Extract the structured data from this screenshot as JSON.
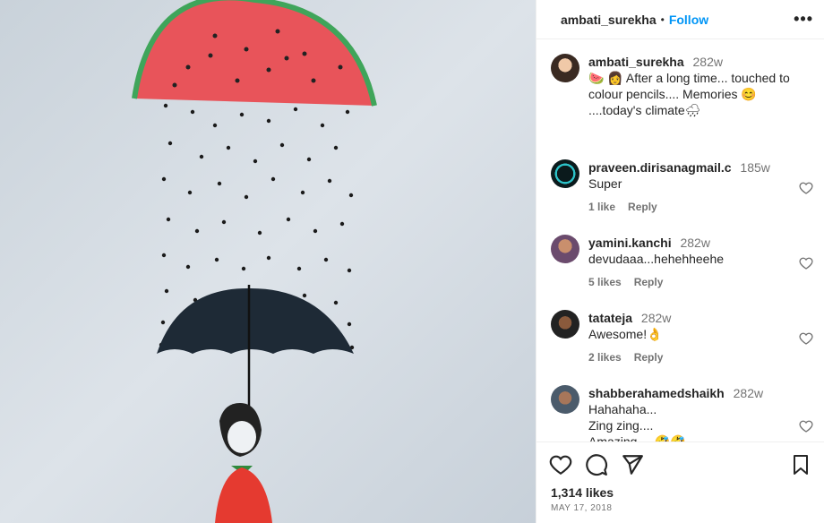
{
  "post": {
    "username": "ambati_surekha",
    "separator": "•",
    "follow_label": "Follow",
    "more_icon": "more-options-icon"
  },
  "caption": {
    "username": "ambati_surekha",
    "time": "282w",
    "text": "🍉 👩 After a long time... touched to colour pencils.... Memories 😊 ....today's climate🌧"
  },
  "comments": [
    {
      "username": "praveen.dirisanagmail.c",
      "time": "185w",
      "text": "Super",
      "likes": "1 like",
      "reply": "Reply"
    },
    {
      "username": "yamini.kanchi",
      "time": "282w",
      "text": "devudaaa...hehehheehe",
      "likes": "5 likes",
      "reply": "Reply"
    },
    {
      "username": "tatateja",
      "time": "282w",
      "text": "Awesome!👌",
      "likes": "2 likes",
      "reply": "Reply"
    },
    {
      "username": "shabberahamedshaikh",
      "time": "282w",
      "text1": "Hahahaha...",
      "text2": "Zing zing....",
      "text3": "Amazing.....🤣🤣"
    }
  ],
  "footer": {
    "likes": "1,314 likes",
    "date": "MAY 17, 2018"
  },
  "colors": {
    "follow": "#0095f6",
    "muted": "#737373",
    "watermelon": "#e8545a",
    "rind": "#3fa55a",
    "umbrella": "#1e2a36",
    "dress": "#e53a30"
  }
}
